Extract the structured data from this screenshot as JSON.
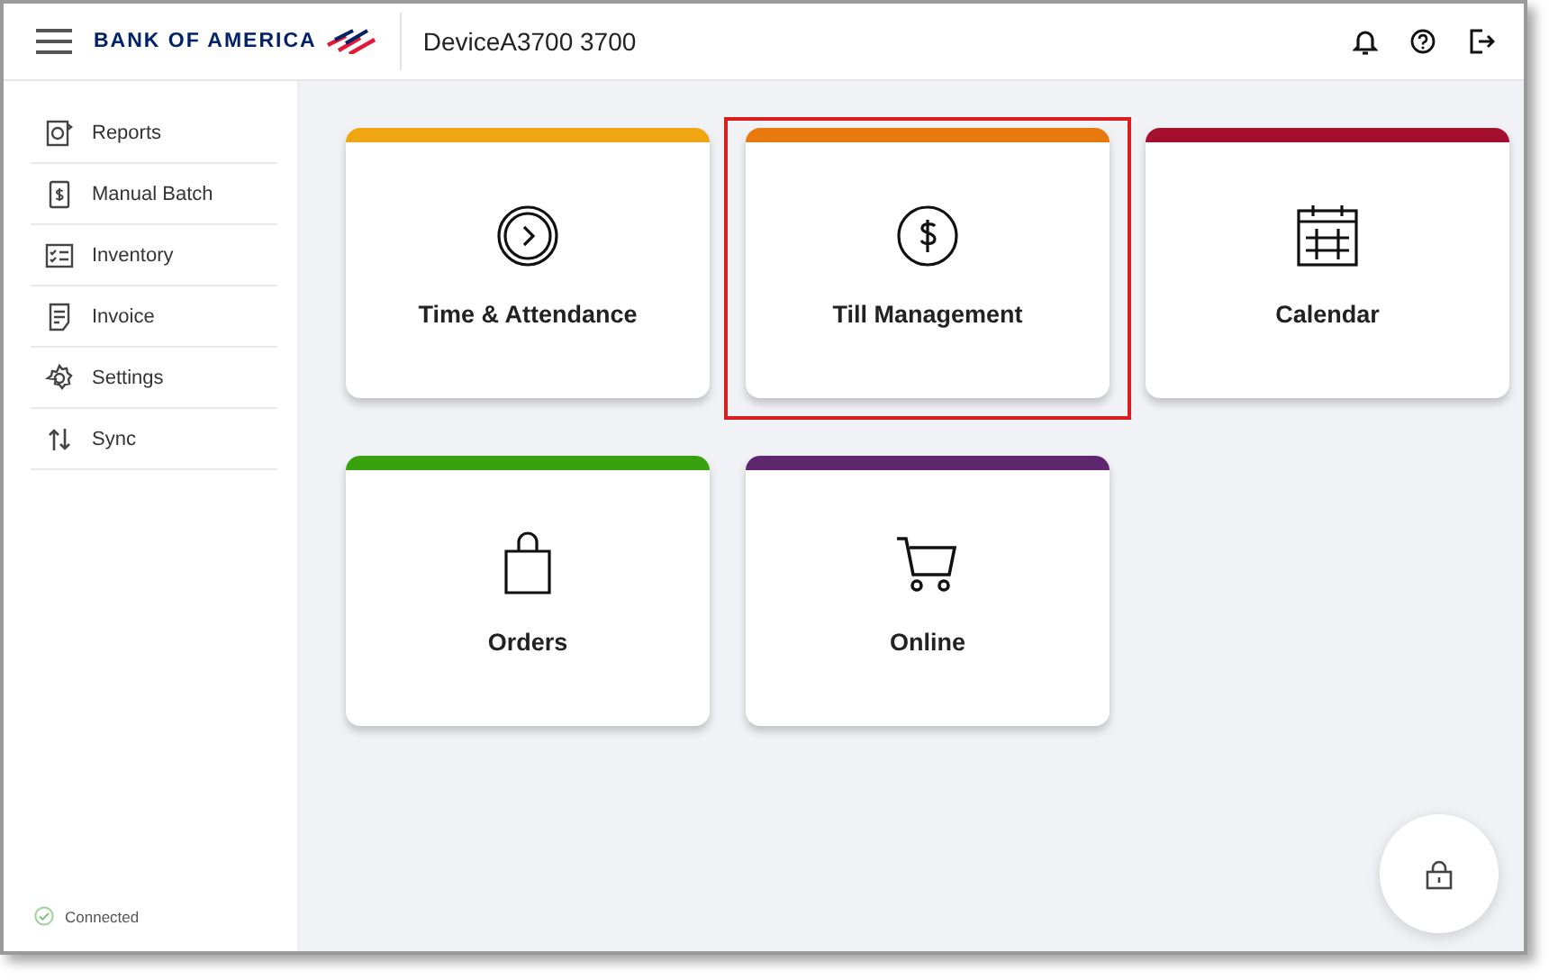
{
  "header": {
    "brand": "BANK OF AMERICA",
    "device": "DeviceA3700 3700"
  },
  "sidebar": {
    "items": [
      {
        "label": "Reports",
        "kind": "reports"
      },
      {
        "label": "Manual Batch",
        "kind": "batch"
      },
      {
        "label": "Inventory",
        "kind": "inventory"
      },
      {
        "label": "Invoice",
        "kind": "invoice"
      },
      {
        "label": "Settings",
        "kind": "settings"
      },
      {
        "label": "Sync",
        "kind": "sync"
      }
    ],
    "status": "Connected"
  },
  "tiles": [
    {
      "label": "Time & Attendance",
      "kind": "clock",
      "color": "#f0a513",
      "highlighted": false
    },
    {
      "label": "Till Management",
      "kind": "dollar",
      "color": "#e7790f",
      "highlighted": true
    },
    {
      "label": "Calendar",
      "kind": "calendar",
      "color": "#a5102e",
      "highlighted": false
    },
    {
      "label": "Orders",
      "kind": "bag",
      "color": "#3aa10e",
      "highlighted": false
    },
    {
      "label": "Online",
      "kind": "cart",
      "color": "#5e2770",
      "highlighted": false
    }
  ]
}
